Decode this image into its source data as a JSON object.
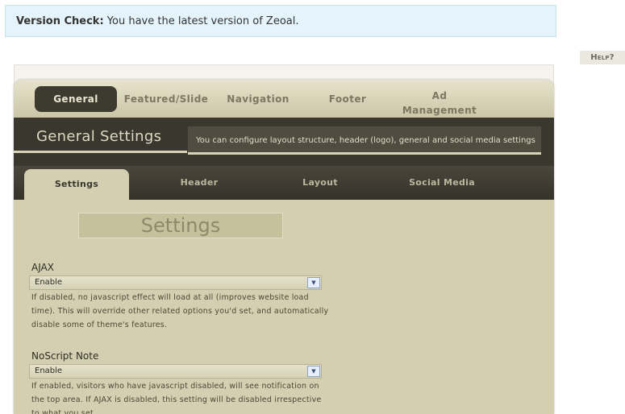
{
  "notice": {
    "label": "Version Check:",
    "text": "You have the latest version of Zeoal."
  },
  "help": {
    "label": "Help?"
  },
  "top_nav": [
    {
      "label": "General"
    },
    {
      "label": "Featured/Slide"
    },
    {
      "label": "Navigation"
    },
    {
      "label": "Footer"
    },
    {
      "label": "Ad Management"
    }
  ],
  "section": {
    "title": "General Settings",
    "description": "You can configure layout structure, header (logo), general and social media settings"
  },
  "sub_nav": [
    {
      "label": "Settings"
    },
    {
      "label": "Header"
    },
    {
      "label": "Layout"
    },
    {
      "label": "Social Media"
    }
  ],
  "content": {
    "heading": "Settings",
    "fields": [
      {
        "label": "AJAX",
        "value": "Enable",
        "description": "If disabled, no javascript effect will load at all (improves website load time). This will override other related options you'd set, and automatically disable some of theme's features."
      },
      {
        "label": "NoScript Note",
        "value": "Enable",
        "description": "If enabled, visitors who have javascript disabled, will see notification on the top area. If AJAX is disabled, this setting will be disabled irrespective to what you set."
      }
    ]
  },
  "icons": {
    "select_arrow": "chevron-down-icon"
  }
}
